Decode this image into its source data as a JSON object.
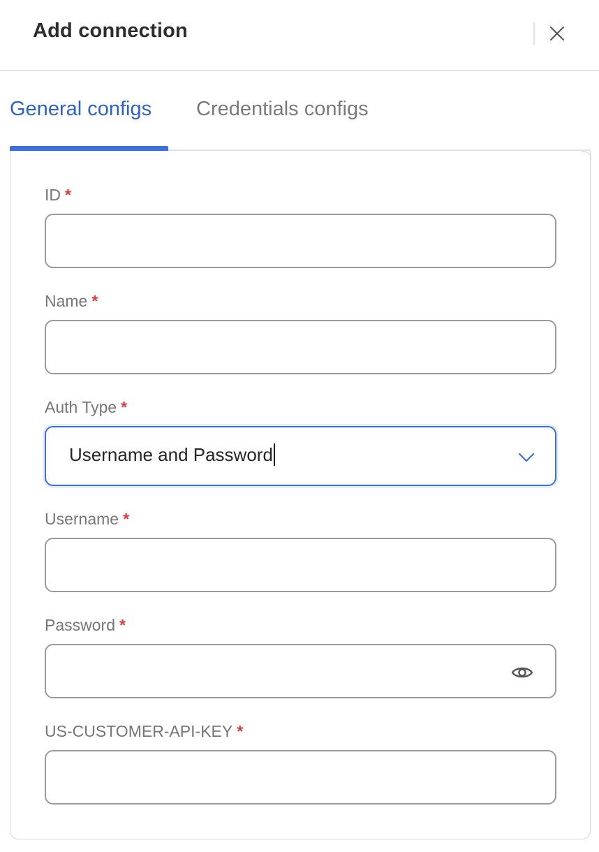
{
  "dialog": {
    "title": "Add connection"
  },
  "tabs": [
    {
      "label": "General configs",
      "active": true
    },
    {
      "label": "Credentials configs",
      "active": false
    }
  ],
  "fields": {
    "id": {
      "label": "ID",
      "required_mark": "*",
      "value": ""
    },
    "name": {
      "label": "Name",
      "required_mark": "*",
      "value": ""
    },
    "auth_type": {
      "label": "Auth Type",
      "required_mark": "*",
      "value": "Username and Password"
    },
    "username": {
      "label": "Username",
      "required_mark": "*",
      "value": ""
    },
    "password": {
      "label": "Password",
      "required_mark": "*",
      "value": ""
    },
    "api_key": {
      "label": "US-CUSTOMER-API-KEY",
      "required_mark": "*",
      "value": ""
    }
  },
  "icons": {
    "close": "close-icon",
    "dropdown": "chevron-down-icon",
    "show_password": "eye-icon"
  },
  "colors": {
    "accent": "#3b6fe0",
    "active_tab_text": "#2f62c9",
    "required": "#e0393e"
  }
}
